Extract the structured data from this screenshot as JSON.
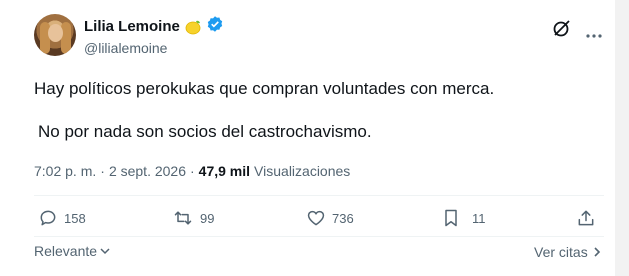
{
  "user": {
    "display_name": "Lilia Lemoine",
    "handle": "@lilialemoine",
    "emoji_icon": "lemon-emoji",
    "verified_color": "#1d9bf0"
  },
  "tweet": {
    "line1": "Hay políticos perokukas que compran voluntades con merca.",
    "line2": "No por nada son socios del castrochavismo."
  },
  "meta": {
    "time": "7:02 p. m.",
    "sep1": "·",
    "date": "2 sept. 2026",
    "sep2": "·",
    "views_count": "47,9 mil",
    "views_label": "Visualizaciones"
  },
  "actions": {
    "replies": "158",
    "retweets": "99",
    "likes": "736",
    "bookmarks": "11"
  },
  "footer": {
    "sort_label": "Relevante",
    "quotes_label": "Ver citas"
  },
  "colors": {
    "text": "#0f1419",
    "secondary": "#536471",
    "verified": "#1d9bf0"
  }
}
